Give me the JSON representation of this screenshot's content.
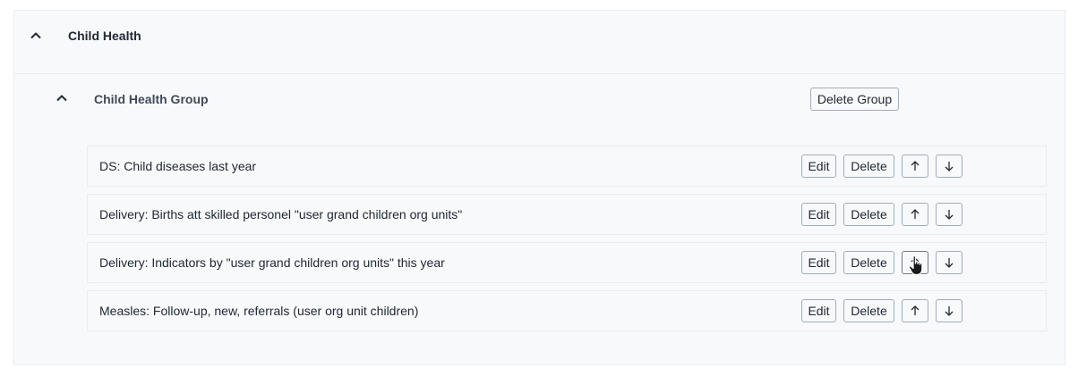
{
  "section": {
    "title": "Child Health",
    "collapse_icon": "chevron-up-icon"
  },
  "group": {
    "title": "Child Health Group",
    "collapse_icon": "chevron-up-icon",
    "delete_label": "Delete Group"
  },
  "items": [
    {
      "label": "DS: Child diseases last year",
      "edit_label": "Edit",
      "delete_label": "Delete",
      "up_icon": "arrow-up-icon",
      "down_icon": "arrow-down-icon"
    },
    {
      "label": "Delivery: Births att skilled personel \"user grand children org units\"",
      "edit_label": "Edit",
      "delete_label": "Delete",
      "up_icon": "arrow-up-icon",
      "down_icon": "arrow-down-icon"
    },
    {
      "label": "Delivery: Indicators by \"user grand children org units\" this year",
      "edit_label": "Edit",
      "delete_label": "Delete",
      "up_icon": "arrow-up-icon",
      "down_icon": "arrow-down-icon"
    },
    {
      "label": "Measles: Follow-up, new, referrals (user org unit children)",
      "edit_label": "Edit",
      "delete_label": "Delete",
      "up_icon": "arrow-up-icon",
      "down_icon": "arrow-down-icon"
    }
  ],
  "cursor": {
    "icon": "hand-pointer-icon"
  }
}
